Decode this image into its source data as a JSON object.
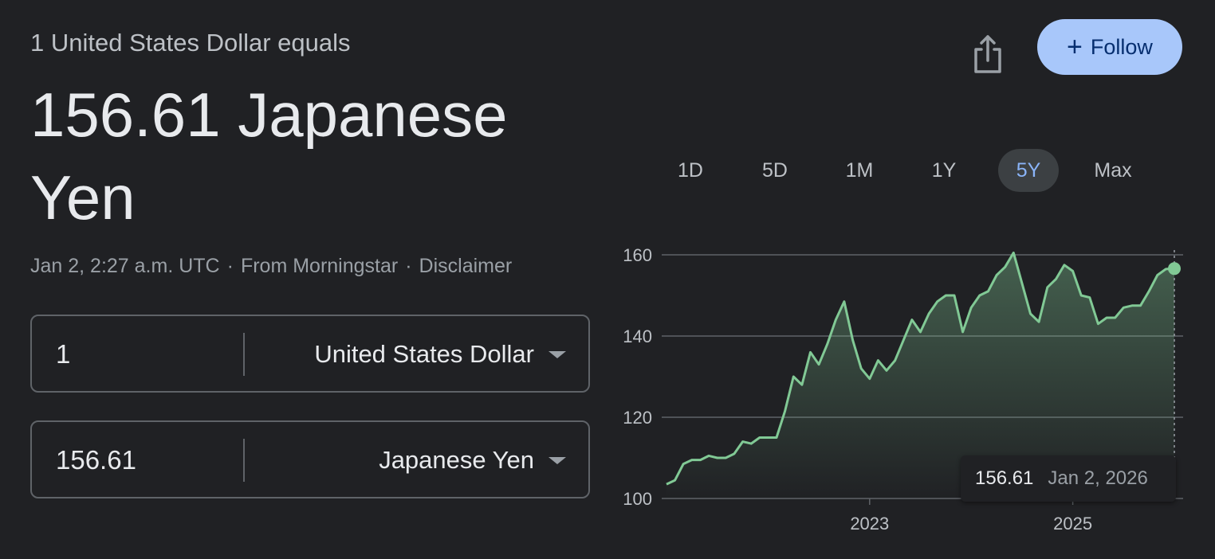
{
  "header": {
    "subtitle": "1 United States Dollar equals",
    "headline": "156.61 Japanese Yen"
  },
  "meta": {
    "timestamp": "Jan 2, 2:27 a.m. UTC",
    "source": "From Morningstar",
    "disclaimer": "Disclaimer",
    "separator": "·"
  },
  "converter": {
    "from": {
      "amount": "1",
      "currency": "United States Dollar"
    },
    "to": {
      "amount": "156.61",
      "currency": "Japanese Yen"
    }
  },
  "actions": {
    "follow_label": "Follow",
    "follow_icon": "plus-icon",
    "share_icon": "share-icon"
  },
  "ranges": {
    "items": [
      "1D",
      "5D",
      "1M",
      "1Y",
      "5Y",
      "Max"
    ],
    "active": "5Y"
  },
  "tooltip": {
    "value": "156.61",
    "date": "Jan 2, 2026"
  },
  "colors": {
    "background": "#202124",
    "line": "#81c995",
    "accent": "#8ab4f8",
    "follow_bg": "#a8c7fa"
  },
  "chart_data": {
    "type": "area",
    "x": [
      "2021-01",
      "2021-02",
      "2021-03",
      "2021-04",
      "2021-05",
      "2021-06",
      "2021-07",
      "2021-08",
      "2021-09",
      "2021-10",
      "2021-11",
      "2021-12",
      "2022-01",
      "2022-02",
      "2022-03",
      "2022-04",
      "2022-05",
      "2022-06",
      "2022-07",
      "2022-08",
      "2022-09",
      "2022-10",
      "2022-11",
      "2022-12",
      "2023-01",
      "2023-02",
      "2023-03",
      "2023-04",
      "2023-05",
      "2023-06",
      "2023-07",
      "2023-08",
      "2023-09",
      "2023-10",
      "2023-11",
      "2023-12",
      "2024-01",
      "2024-02",
      "2024-03",
      "2024-04",
      "2024-05",
      "2024-06",
      "2024-07",
      "2024-08",
      "2024-09",
      "2024-10",
      "2024-11",
      "2024-12",
      "2025-01",
      "2025-02",
      "2025-03",
      "2025-04",
      "2025-05",
      "2025-06",
      "2025-07",
      "2025-08",
      "2025-09",
      "2025-10",
      "2025-11",
      "2025-12",
      "2026-01"
    ],
    "series": [
      {
        "values": [
          103.5,
          104.5,
          108.5,
          109.5,
          109.5,
          110.5,
          110,
          110,
          111,
          114,
          113.5,
          115,
          115,
          115,
          121.5,
          130,
          128,
          136,
          133,
          138,
          144,
          148.5,
          139,
          132,
          129.5,
          134,
          131.5,
          134,
          139,
          144,
          141,
          145.5,
          148.5,
          150,
          150,
          141,
          147,
          150,
          151,
          155,
          157,
          160.5,
          153,
          145.5,
          143.5,
          152,
          154,
          157.5,
          156,
          150,
          149.5,
          143,
          144.5,
          144.5,
          147,
          147.5,
          147.5,
          151,
          155,
          156.5,
          156.61
        ]
      }
    ],
    "xticks": [
      "2023",
      "2025"
    ],
    "yticks": [
      100,
      120,
      140,
      160
    ],
    "ylim": [
      100,
      160
    ],
    "grid": true,
    "title": "",
    "xlabel": "",
    "ylabel": ""
  }
}
